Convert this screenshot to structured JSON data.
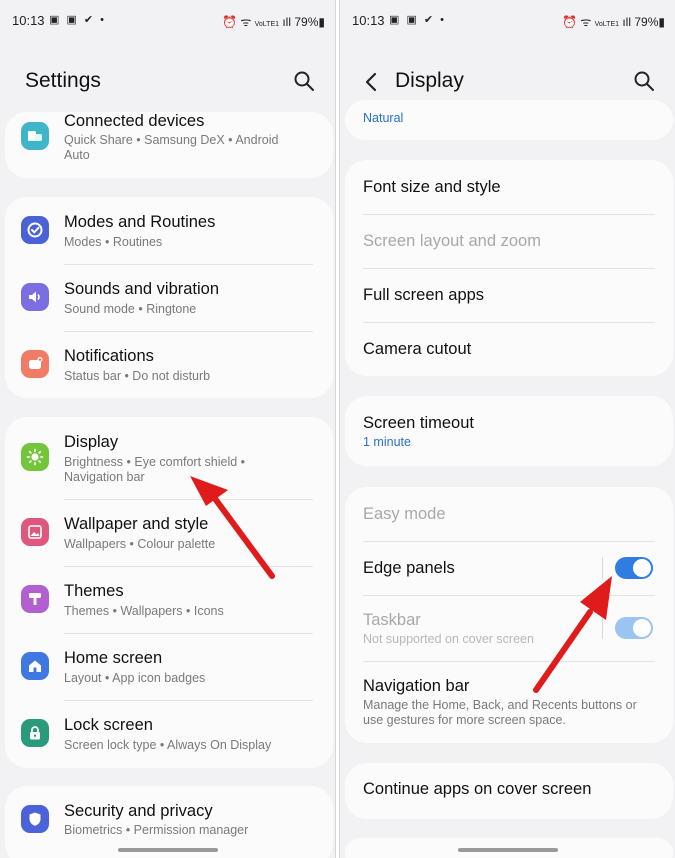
{
  "status": {
    "time": "10:13",
    "notif_icons": "▣ ▣ ✔ •",
    "volte": "VoLTE1",
    "battery": "79%"
  },
  "left": {
    "title": "Settings",
    "items": [
      {
        "title": "Connected devices",
        "sub1": "Quick Share  •  Samsung DeX  •  Android",
        "sub2": "Auto",
        "icon": "connected-devices-icon",
        "color": "#3eb5c9"
      },
      {
        "title": "Modes and Routines",
        "sub1": "Modes  •  Routines",
        "icon": "modes-routines-icon",
        "color": "#4a62d6"
      },
      {
        "title": "Sounds and vibration",
        "sub1": "Sound mode  •  Ringtone",
        "icon": "speaker-icon",
        "color": "#7a6ee0"
      },
      {
        "title": "Notifications",
        "sub1": "Status bar  •  Do not disturb",
        "icon": "notifications-icon",
        "color": "#ef7c63"
      },
      {
        "title": "Display",
        "sub1": "Brightness  •  Eye comfort shield  •",
        "sub2": "Navigation bar",
        "icon": "brightness-icon",
        "color": "#74c43c"
      },
      {
        "title": "Wallpaper and style",
        "sub1": "Wallpapers  •  Colour palette",
        "icon": "wallpaper-icon",
        "color": "#e0577e"
      },
      {
        "title": "Themes",
        "sub1": "Themes  •  Wallpapers  •  Icons",
        "icon": "themes-icon",
        "color": "#b25fd0"
      },
      {
        "title": "Home screen",
        "sub1": "Layout  •  App icon badges",
        "icon": "home-icon",
        "color": "#3f78e0"
      },
      {
        "title": "Lock screen",
        "sub1": "Screen lock type  •  Always On Display",
        "icon": "lock-icon",
        "color": "#2a9a7c"
      },
      {
        "title": "Security and privacy",
        "sub1": "Biometrics  •  Permission manager",
        "icon": "shield-icon",
        "color": "#4b62d8"
      }
    ]
  },
  "right": {
    "title": "Display",
    "top_value": "Natural",
    "group1": [
      "Font size and style",
      "Screen layout and zoom",
      "Full screen apps",
      "Camera cutout"
    ],
    "screen_timeout": {
      "title": "Screen timeout",
      "value": "1 minute"
    },
    "easy_mode": "Easy mode",
    "edge_panels": {
      "title": "Edge panels",
      "on": true
    },
    "taskbar": {
      "title": "Taskbar",
      "sub": "Not supported on cover screen",
      "on": true
    },
    "navigation_bar": {
      "title": "Navigation bar",
      "sub1": "Manage the Home, Back, and Recents buttons or",
      "sub2": "use gestures for more screen space."
    },
    "continue_apps": "Continue apps on cover screen"
  },
  "colors": {
    "accent": "#2f7de1",
    "arrow": "#e01b1b"
  }
}
